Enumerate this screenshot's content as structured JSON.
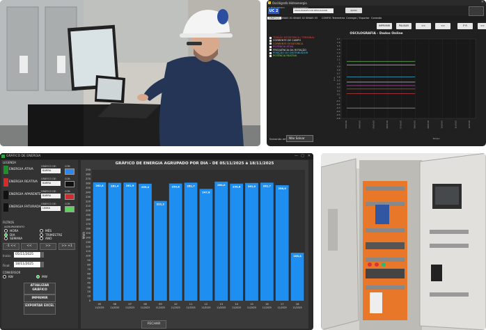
{
  "oscilloscope": {
    "window_title": "Oscilógrafo Hidroenergia",
    "field_labels": [
      "ALMOXARIFADO",
      "OSCILÓGRAFO"
    ],
    "unit_badge": "UC 2",
    "unit_name": "OSCILÓGRAFO DO REGULADOR",
    "status_button": "AJUDA",
    "menu": [
      "GRÁFICO",
      "SINAIS 01",
      "SINAIS 02",
      "SINAIS 03",
      "CONFIG",
      "Telemetria",
      "Carregar / Exportar",
      "Conexão"
    ],
    "toolbar": [
      "IMPRIMIR",
      "PAUSAR",
      "<<",
      "<<",
      "P R",
      ">>"
    ],
    "chart_title": "OSCILOGRAFIA - Dados Online",
    "legend": [
      {
        "label": "TENSÃO ESTATÓRICA / TERMINAL",
        "color": "#e34646"
      },
      {
        "label": "CORRENTE DE CAMPO",
        "color": "#e8e8e8"
      },
      {
        "label": "CORRENTE ESTATÓRICA",
        "color": "#f07b2a"
      },
      {
        "label": "POTÊNCIA ATIVA",
        "color": "#d94ed8"
      },
      {
        "label": "FREQUÊNCIA DA ROTAÇÃO",
        "color": "#e8e8e8"
      },
      {
        "label": "POSIÇÃO DO DISTRIBUIDOR",
        "color": "#42c8f0"
      },
      {
        "label": "POTÊNCIA REATIVA",
        "color": "#7ddf5b"
      }
    ],
    "y_ticks": [
      "1.7",
      "1.6",
      "1.5",
      "1.4",
      "1.3",
      "1.2",
      "1.1",
      "1",
      "0.9",
      "0.8",
      "0.7",
      "0.6",
      "0.5",
      "0.4",
      "0.3",
      "0.2",
      "0.1",
      "0",
      "-0.1",
      "-0.2",
      "-0.3",
      "-0.4",
      "-0.5",
      "-0.6"
    ],
    "x_ticks": [
      "03:00:00",
      "04:00:00",
      "05:00:00",
      "06:00:00",
      "07:00:00",
      "08:00:00",
      "09:00:00",
      "10:00:00",
      "11:00:00",
      "12:00:00"
    ],
    "x_label": "Tempo",
    "y_label": "p.u.",
    "save_label": "Salvando em:",
    "save_value": "Não Salvar"
  },
  "energy_window": {
    "window_title": "GRÁFICO DE ENERGIA",
    "legend_group": "LEGENDA",
    "energies": [
      {
        "label": "ENERGIA ATIVA",
        "swatch": "#1f8f2a",
        "chart_type": "BARRA",
        "color": "#2e86f0"
      },
      {
        "label": "ENERGIA REATIVA",
        "swatch": "#d42b2b",
        "chart_type": "BARRA",
        "color": "#111111"
      },
      {
        "label": "ENERGIA APARENTE",
        "swatch": "#111111",
        "chart_type": "BARRA",
        "color": "#d42b2b"
      },
      {
        "label": "ENERGIA FATURADA",
        "swatch": "#111111",
        "chart_type": "LINHA",
        "color": "#5ed35b"
      }
    ],
    "mini_labels": {
      "type": "GRÁFICO DE:",
      "color": "COR:"
    },
    "filters_group": "FILTROS",
    "grouping_group": "AGRUPAMENTO",
    "grouping_options": [
      {
        "label": "HORA",
        "selected": false
      },
      {
        "label": "MÊS",
        "selected": false
      },
      {
        "label": "DIA",
        "selected": true
      },
      {
        "label": "TRIMESTRE",
        "selected": false
      },
      {
        "label": "SEMANA",
        "selected": false
      },
      {
        "label": "ANO",
        "selected": false
      }
    ],
    "nav_buttons": [
      "-1 <<",
      "<<",
      ">>",
      ">> +1"
    ],
    "start_label": "Inicio:",
    "start_value": "05/11/2025",
    "end_label": "Final:",
    "end_value": "18/11/2025",
    "converter_group": "CONVERSOR",
    "converter_options": [
      {
        "label": "KW",
        "selected": false
      },
      {
        "label": "MW",
        "selected": true
      }
    ],
    "buttons": {
      "update": "ATUALIZAR GRÁFICO",
      "print": "IMPRIMIR",
      "export": "EXPORTAR EXCEL",
      "close": "FECHAR"
    }
  },
  "chart_data": {
    "type": "bar",
    "title": "GRÁFICO DE ENERGIA AGRUPADO POR DIA - DE 05/11/2025 à 18/11/2025",
    "ylabel": "MWh",
    "xlabel": "",
    "ylim": [
      0,
      290
    ],
    "yticks": [
      0,
      10,
      20,
      30,
      40,
      50,
      60,
      70,
      80,
      90,
      100,
      110,
      120,
      130,
      140,
      150,
      160,
      170,
      180,
      190,
      200,
      210,
      220,
      230,
      240,
      250,
      260,
      270,
      280,
      290
    ],
    "categories": [
      "05 11/2025",
      "06 11/2025",
      "07 11/2025",
      "08 11/2025",
      "09 11/2025",
      "10 11/2025",
      "11 11/2025",
      "12 11/2025",
      "13 11/2025",
      "14 11/2025",
      "15 11/2025",
      "16 11/2025",
      "17 11/2025",
      "18 11/2025"
    ],
    "category_day": [
      "05",
      "06",
      "07",
      "08",
      "09",
      "10",
      "11",
      "12",
      "13",
      "14",
      "15",
      "16",
      "17",
      "18"
    ],
    "category_month": "11/2025",
    "series": [
      {
        "values": [
          262.4,
          261.4,
          261.9,
          259.4,
          221.2,
          259.8,
          261.7,
          247.8,
          264.0,
          259.6,
          261.0,
          261.7,
          256.0,
          106.4
        ],
        "color": "#1f8ef1"
      }
    ],
    "value_labels": [
      "262,4",
      "261,4",
      "261,9",
      "259,4",
      "221,2",
      "259,8",
      "261,7",
      "247,8",
      "264,0",
      "259,6",
      "261,0",
      "261,7",
      "256,0",
      "106,4"
    ],
    "legend": "none",
    "grid": false
  }
}
